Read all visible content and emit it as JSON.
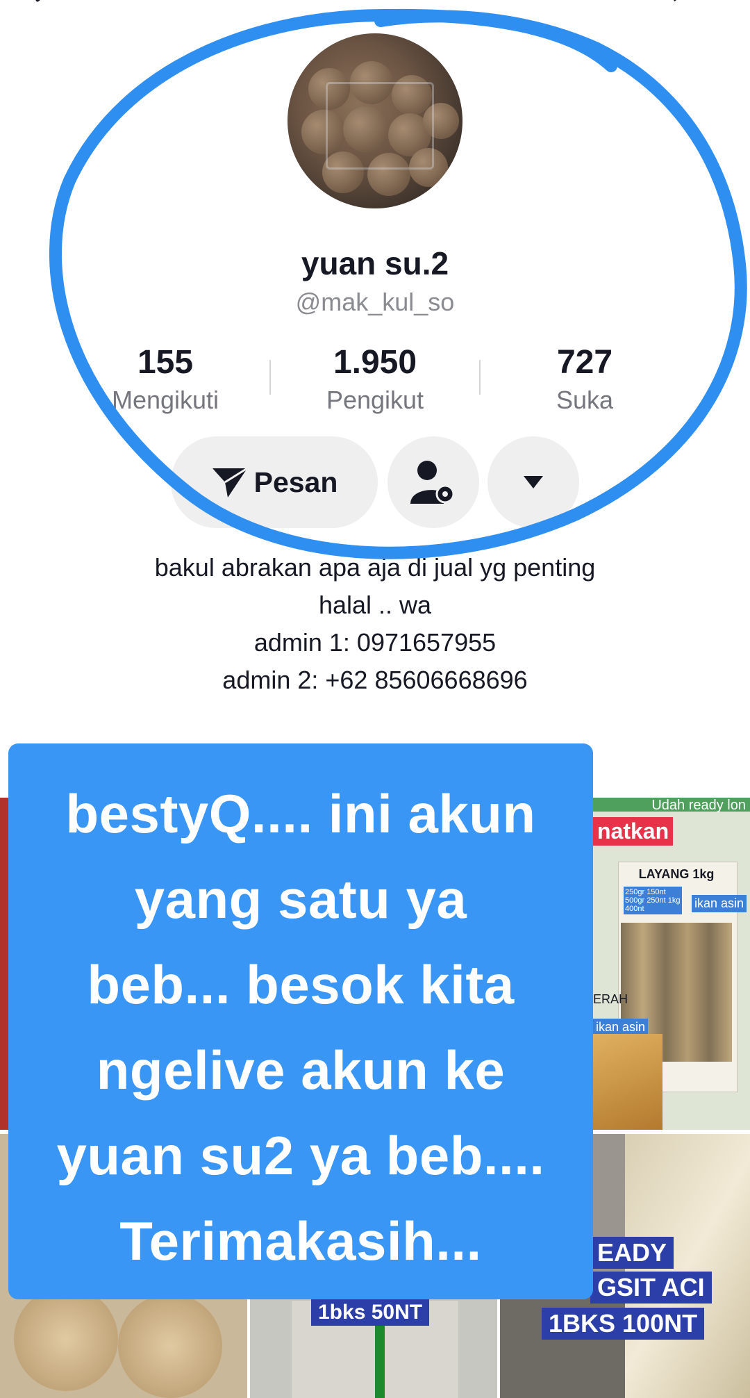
{
  "profile": {
    "display_name": "yuan su.2",
    "handle": "@mak_kul_so",
    "stats": [
      {
        "value": "155",
        "label": "Mengikuti"
      },
      {
        "value": "1.950",
        "label": "Pengikut"
      },
      {
        "value": "727",
        "label": "Suka"
      }
    ],
    "message_button_label": "Pesan",
    "bio_lines": [
      "bakul abrakan apa aja di jual yg penting",
      "halal .. wa",
      "admin 1: 0971657955",
      "admin 2: +62 85606668696"
    ]
  },
  "overlay": {
    "lines": [
      "bestyQ.... ini akun",
      "yang satu ya",
      "beb... besok kita",
      "ngelive akun ke",
      "yuan su2 ya beb....",
      "Terimakasih..."
    ]
  },
  "grid": {
    "tile_right_top": {
      "banner_top": "Udah ready lon",
      "red_tag": "natkan",
      "product_title": "LAYANG 1kg",
      "prices": "250gr 150nt 500gr 250nt 1kg 400nt",
      "tag": "ikan asin",
      "side_label": "ERAH",
      "side_tag": "ikan asin"
    },
    "tile_mid_bottom": {
      "price_tag": "1bks 50NT"
    },
    "tile_right_bottom": {
      "line1": "EADY",
      "line2": "GSIT ACI",
      "line3": "1BKS 100NT"
    }
  },
  "colors": {
    "circle_annotation": "#2f8ff0",
    "overlay_bg": "#3a96f5",
    "button_bg": "#efefef"
  }
}
